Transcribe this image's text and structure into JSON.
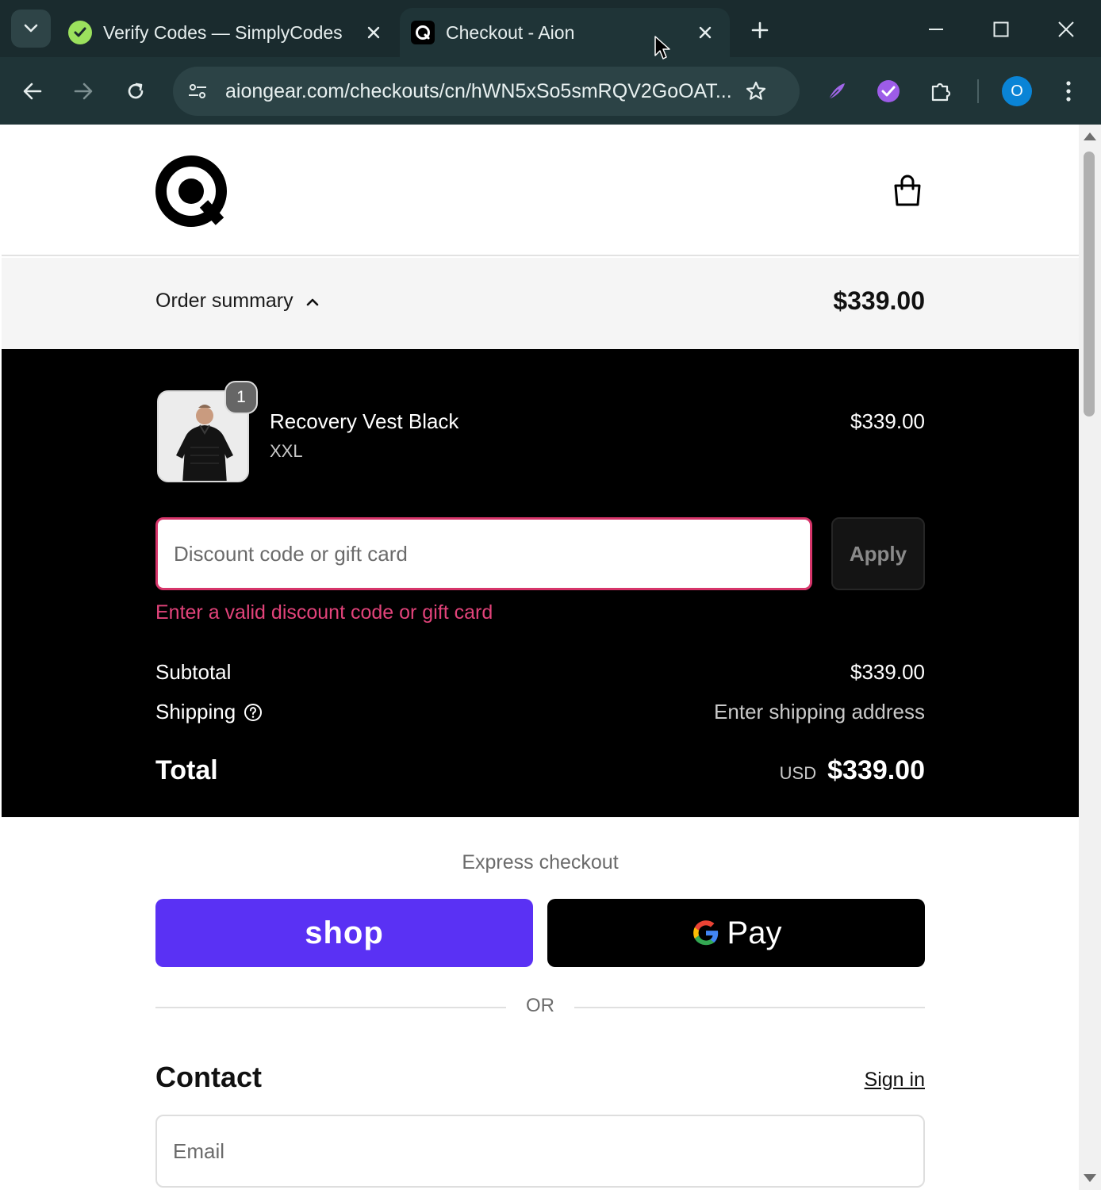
{
  "browser": {
    "tabs": [
      {
        "title": "Verify Codes — SimplyCodes",
        "active": false,
        "favicon": "simplycodes-icon"
      },
      {
        "title": "Checkout - Aion",
        "active": true,
        "favicon": "aion-icon"
      }
    ],
    "url": "aiongear.com/checkouts/cn/hWN5xSo5smRQV2GoOAT...",
    "profile_initial": "O",
    "colors": {
      "tabstrip": "#1a2b2e",
      "toolbar": "#1f3437",
      "profile": "#0a84d6"
    }
  },
  "order_summary": {
    "toggle_label": "Order summary",
    "total": "$339.00"
  },
  "line_item": {
    "name": "Recovery Vest Black",
    "variant": "XXL",
    "quantity": "1",
    "price": "$339.00"
  },
  "discount": {
    "placeholder": "Discount code or gift card",
    "apply_label": "Apply",
    "error": "Enter a valid discount code or gift card",
    "error_color": "#e2437a"
  },
  "totals": {
    "subtotal_label": "Subtotal",
    "subtotal_value": "$339.00",
    "shipping_label": "Shipping",
    "shipping_value": "Enter shipping address",
    "total_label": "Total",
    "currency": "USD",
    "total_value": "$339.00"
  },
  "express": {
    "label": "Express checkout",
    "shop_label": "shop",
    "shop_color": "#5a31f4",
    "gpay_label": "Pay",
    "or_label": "OR"
  },
  "contact": {
    "title": "Contact",
    "signin_label": "Sign in",
    "email_placeholder": "Email"
  }
}
